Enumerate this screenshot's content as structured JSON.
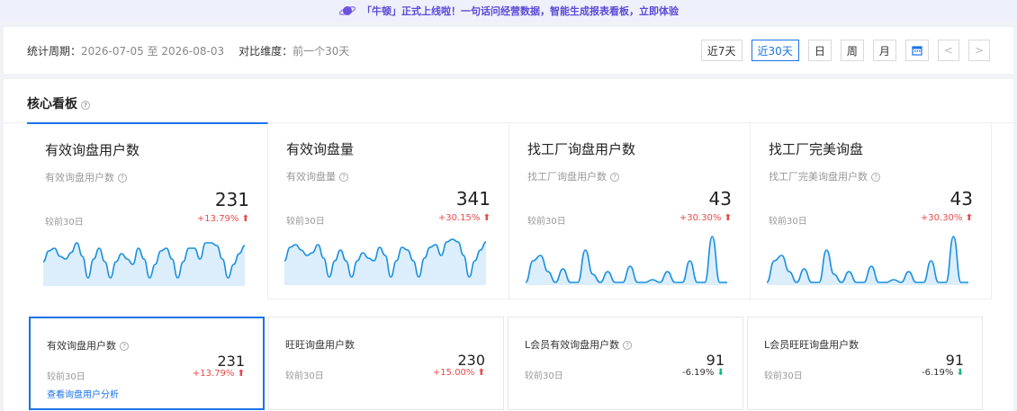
{
  "banner": {
    "text": "「牛顿」正式上线啦！一句话问经营数据，智能生成报表看板，立即体验"
  },
  "filter": {
    "period_label": "统计周期：",
    "period_value": "2026-07-05 至 2026-08-03",
    "compare_label": "对比维度：",
    "compare_value": "前一个30天",
    "buttons": [
      "近7天",
      "近30天",
      "日",
      "周",
      "月"
    ],
    "active_button": "近30天",
    "nav_prev": "<",
    "nav_next": ">"
  },
  "panel": {
    "title": "核心看板",
    "help": "?"
  },
  "cards": [
    {
      "title": "有效询盘用户数",
      "subtitle": "有效询盘用户数",
      "value": "231",
      "compare_label": "较前30日",
      "change": "+13.79%",
      "direction": "up",
      "spark": [
        0.55,
        0.35,
        0.3,
        0.45,
        0.5,
        0.38,
        0.2,
        0.45,
        0.85,
        0.5,
        0.3,
        0.55,
        0.85,
        0.55,
        0.4,
        0.5,
        0.6,
        0.3,
        0.5,
        0.85,
        0.6,
        0.35,
        0.3,
        0.5,
        0.85,
        0.55,
        0.3,
        0.3,
        0.5,
        0.2,
        0.2,
        0.25,
        0.5,
        0.85,
        0.6,
        0.4,
        0.25
      ]
    },
    {
      "title": "有效询盘量",
      "subtitle": "有效询盘量",
      "value": "341",
      "compare_label": "较前30日",
      "change": "+30.15%",
      "direction": "up",
      "spark": [
        0.55,
        0.3,
        0.25,
        0.35,
        0.45,
        0.4,
        0.25,
        0.5,
        0.85,
        0.55,
        0.35,
        0.55,
        0.85,
        0.55,
        0.4,
        0.5,
        0.55,
        0.3,
        0.45,
        0.85,
        0.55,
        0.3,
        0.35,
        0.55,
        0.85,
        0.5,
        0.3,
        0.25,
        0.45,
        0.2,
        0.15,
        0.2,
        0.45,
        0.85,
        0.55,
        0.35,
        0.2
      ]
    },
    {
      "title": "找工厂询盘用户数",
      "subtitle": "找工厂询盘用户数",
      "value": "43",
      "compare_label": "较前30日",
      "change": "+30.30%",
      "direction": "up",
      "spark": [
        0.95,
        0.55,
        0.45,
        0.75,
        0.95,
        0.7,
        0.95,
        0.95,
        0.35,
        0.8,
        0.95,
        0.75,
        0.95,
        0.95,
        0.65,
        0.95,
        0.95,
        0.9,
        0.95,
        0.75,
        0.95,
        0.95,
        0.55,
        0.95,
        0.95,
        0.1,
        0.95,
        0.95
      ]
    },
    {
      "title": "找工厂完美询盘",
      "subtitle": "找工厂完美询盘用户数",
      "value": "43",
      "compare_label": "较前30日",
      "change": "+30.30%",
      "direction": "up",
      "spark": [
        0.95,
        0.55,
        0.45,
        0.75,
        0.95,
        0.7,
        0.95,
        0.95,
        0.35,
        0.8,
        0.95,
        0.75,
        0.95,
        0.95,
        0.65,
        0.95,
        0.95,
        0.9,
        0.95,
        0.75,
        0.95,
        0.95,
        0.55,
        0.95,
        0.95,
        0.1,
        0.95,
        0.95
      ]
    }
  ],
  "subcards": [
    {
      "title": "有效询盘用户数",
      "value": "231",
      "compare_label": "较前30日",
      "change": "+13.79%",
      "direction": "up",
      "link": "查看询盘用户分析"
    },
    {
      "title": "旺旺询盘用户数",
      "value": "230",
      "compare_label": "较前30日",
      "change": "+15.00%",
      "direction": "up"
    },
    {
      "title": "L会员有效询盘用户数",
      "value": "91",
      "compare_label": "较前30日",
      "change": "-6.19%",
      "direction": "down"
    },
    {
      "title": "L会员旺旺询盘用户数",
      "value": "91",
      "compare_label": "较前30日",
      "change": "-6.19%",
      "direction": "down"
    }
  ],
  "colors": {
    "accent": "#1a73e8",
    "up": "#e84a4a",
    "down": "#1bb48a",
    "spark_line": "#1a8fe0",
    "spark_fill": "#dceefb"
  }
}
